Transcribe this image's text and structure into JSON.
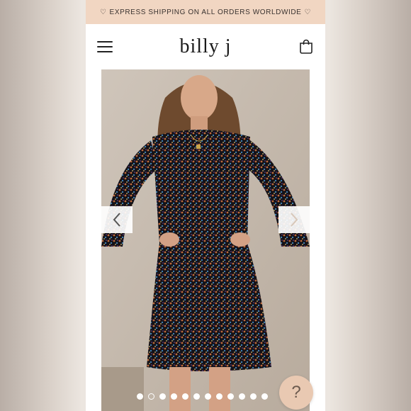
{
  "promo": {
    "heart_left": "♡",
    "text": "EXPRESS SHIPPING ON ALL ORDERS WORLDWIDE",
    "heart_right": "♡"
  },
  "header": {
    "logo": "billy j",
    "menu_icon": "hamburger-menu-icon",
    "cart_icon": "shopping-bag-icon"
  },
  "gallery": {
    "prev_icon": "chevron-left-icon",
    "next_icon": "chevron-right-icon",
    "slide_count": 12,
    "active_slide": 2
  },
  "help": {
    "label": "?"
  },
  "colors": {
    "promo_bg": "#f1d6c2",
    "help_bg": "#e9c9b2",
    "text": "#1a1a1a"
  }
}
